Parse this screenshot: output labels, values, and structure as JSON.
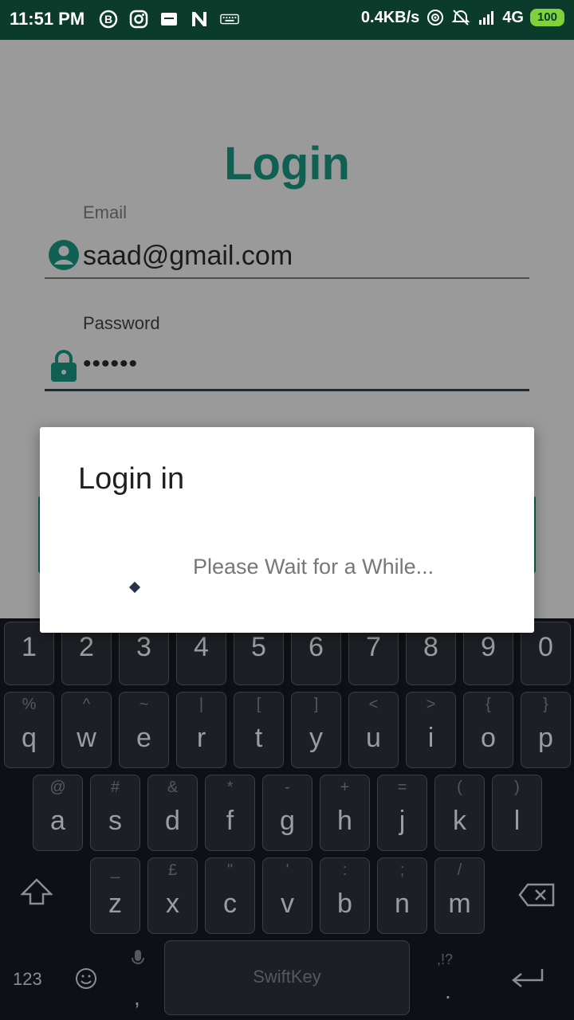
{
  "status_bar": {
    "time": "11:51 PM",
    "net_speed": "0.4KB/s",
    "network_type": "4G",
    "battery": "100",
    "icons": [
      "b-icon",
      "instagram-icon",
      "notification-icon",
      "n-icon",
      "keyboard-icon",
      "hotspot-icon",
      "alarm-off-icon",
      "signal-icon"
    ]
  },
  "login": {
    "title": "Login",
    "email_label": "Email",
    "email_value": "saad@gmail.com",
    "password_label": "Password",
    "password_value": "••••••"
  },
  "dialog": {
    "title": "Login in",
    "message": "Please Wait for a While..."
  },
  "keyboard": {
    "number_row": [
      "1",
      "2",
      "3",
      "4",
      "5",
      "6",
      "7",
      "8",
      "9",
      "0"
    ],
    "row1": [
      {
        "main": "q",
        "alt": "%"
      },
      {
        "main": "w",
        "alt": "^"
      },
      {
        "main": "e",
        "alt": "~"
      },
      {
        "main": "r",
        "alt": "|"
      },
      {
        "main": "t",
        "alt": "["
      },
      {
        "main": "y",
        "alt": "]"
      },
      {
        "main": "u",
        "alt": "<"
      },
      {
        "main": "i",
        "alt": ">"
      },
      {
        "main": "o",
        "alt": "{"
      },
      {
        "main": "p",
        "alt": "}"
      }
    ],
    "row2": [
      {
        "main": "a",
        "alt": "@"
      },
      {
        "main": "s",
        "alt": "#"
      },
      {
        "main": "d",
        "alt": "&"
      },
      {
        "main": "f",
        "alt": "*"
      },
      {
        "main": "g",
        "alt": "-"
      },
      {
        "main": "h",
        "alt": "+"
      },
      {
        "main": "j",
        "alt": "="
      },
      {
        "main": "k",
        "alt": "("
      },
      {
        "main": "l",
        "alt": ")"
      }
    ],
    "row3": [
      {
        "main": "z",
        "alt": "_"
      },
      {
        "main": "x",
        "alt": "£"
      },
      {
        "main": "c",
        "alt": "\""
      },
      {
        "main": "v",
        "alt": "'"
      },
      {
        "main": "b",
        "alt": ":"
      },
      {
        "main": "n",
        "alt": ";"
      },
      {
        "main": "m",
        "alt": "/"
      }
    ],
    "symbols_label": "123",
    "space_label": "SwiftKey",
    "comma": ",",
    "period": ".",
    "punct_hint": ",!?",
    "colors": {
      "background": "#0d1014",
      "key": "#1c1f24"
    }
  },
  "colors": {
    "accent": "#0f5f52",
    "status_bar": "#0b3b2b"
  }
}
